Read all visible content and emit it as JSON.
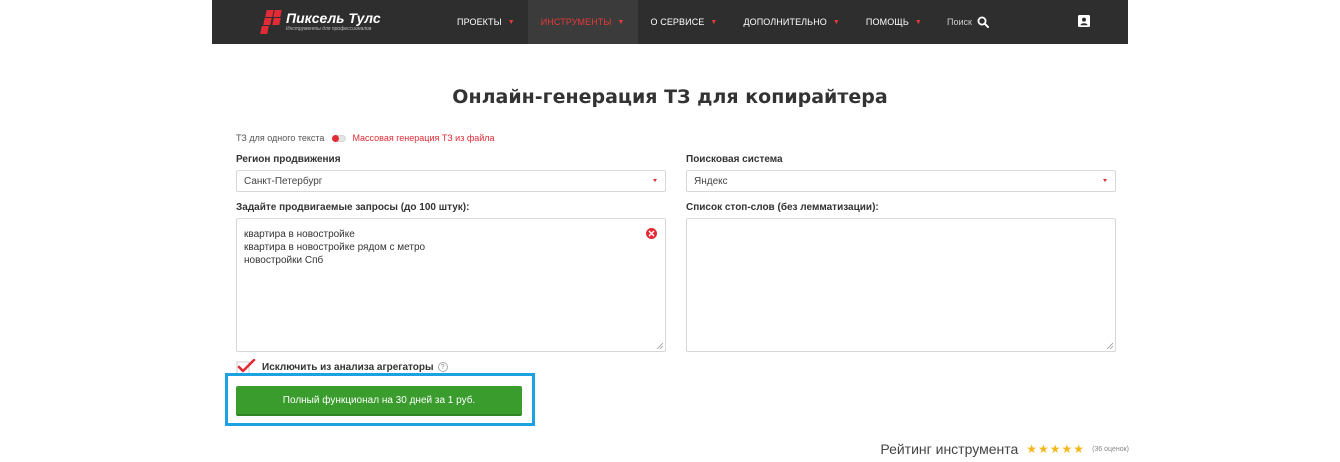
{
  "header": {
    "logo_name": "Пиксель Тулс",
    "logo_tagline": "Инструменты для профессионалов",
    "nav": [
      {
        "label": "Проекты",
        "active": false
      },
      {
        "label": "Инструменты",
        "active": true
      },
      {
        "label": "О сервисе",
        "active": false
      },
      {
        "label": "Дополнительно",
        "active": false
      },
      {
        "label": "Помощь",
        "active": false
      }
    ],
    "search_label": "Поиск"
  },
  "page": {
    "title": "Онлайн-генерация ТЗ для копирайтера"
  },
  "mode": {
    "single_label": "ТЗ для одного текста",
    "bulk_label": "Массовая генерация ТЗ из файла"
  },
  "form": {
    "region_label": "Регион продвижения",
    "region_value": "Санкт-Петербург",
    "engine_label": "Поисковая система",
    "engine_value": "Яндекс",
    "queries_label": "Задайте продвигаемые запросы (до 100 штук):",
    "queries": [
      "квартира в новостройке",
      "квартира в новостройке рядом с метро",
      "новостройки Спб"
    ],
    "stopwords_label": "Список стоп-слов (без лемматизации):",
    "stopwords_value": "",
    "exclude_aggregators_label": "Исключить из анализа агрегаторы",
    "exclude_aggregators_checked": true,
    "help_glyph": "?",
    "cta_label": "Полный функционал на 30 дней за 1 руб."
  },
  "rating": {
    "label": "Рейтинг инструмента",
    "stars": 5,
    "stars_text": "★★★★★",
    "count_label": "(36 оценок)"
  },
  "colors": {
    "topbar": "#2e2e2e",
    "accent_red": "#e32b36",
    "cta_green": "#3b9c2e",
    "highlight_blue": "#1ca2e0",
    "star": "#f3b81f"
  }
}
